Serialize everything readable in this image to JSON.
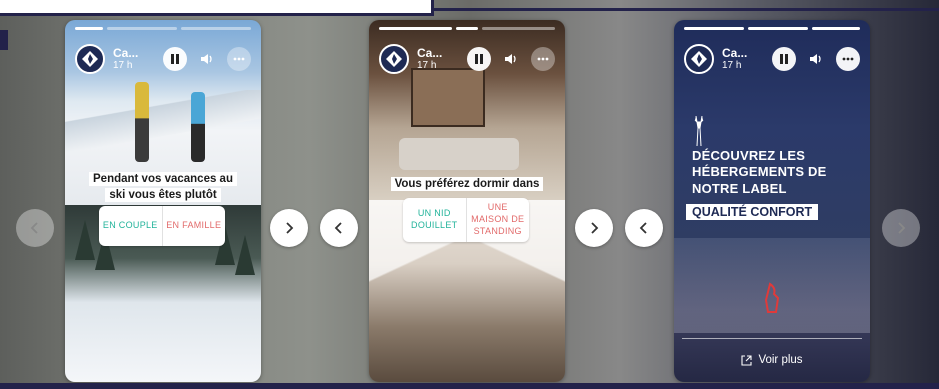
{
  "stories": [
    {
      "account_name": "Ca...",
      "time": "17 h",
      "question": "Pendant vos vacances au ski vous êtes plutôt",
      "options": [
        "EN COUPLE",
        "EN FAMILLE"
      ]
    },
    {
      "account_name": "Ca...",
      "time": "17 h",
      "question": "Vous préférez dormir dans",
      "options": [
        "UN NID DOUILLET",
        "UNE MAISON DE STANDING"
      ]
    },
    {
      "account_name": "Ca...",
      "time": "17 h",
      "headline": "DÉCOUVREZ LES HÉBERGEMENTS DE NOTRE LABEL",
      "label": "QUALITÉ CONFORT",
      "cta": "Voir plus"
    }
  ],
  "colors": {
    "frame": "#23224a",
    "option_a": "#22b39a",
    "option_b": "#e26a6a",
    "brand_avatar": "#1e2a54"
  },
  "icons": [
    "pause-icon",
    "volume-icon",
    "more-icon",
    "chevron-left-icon",
    "chevron-right-icon",
    "external-link-icon"
  ]
}
